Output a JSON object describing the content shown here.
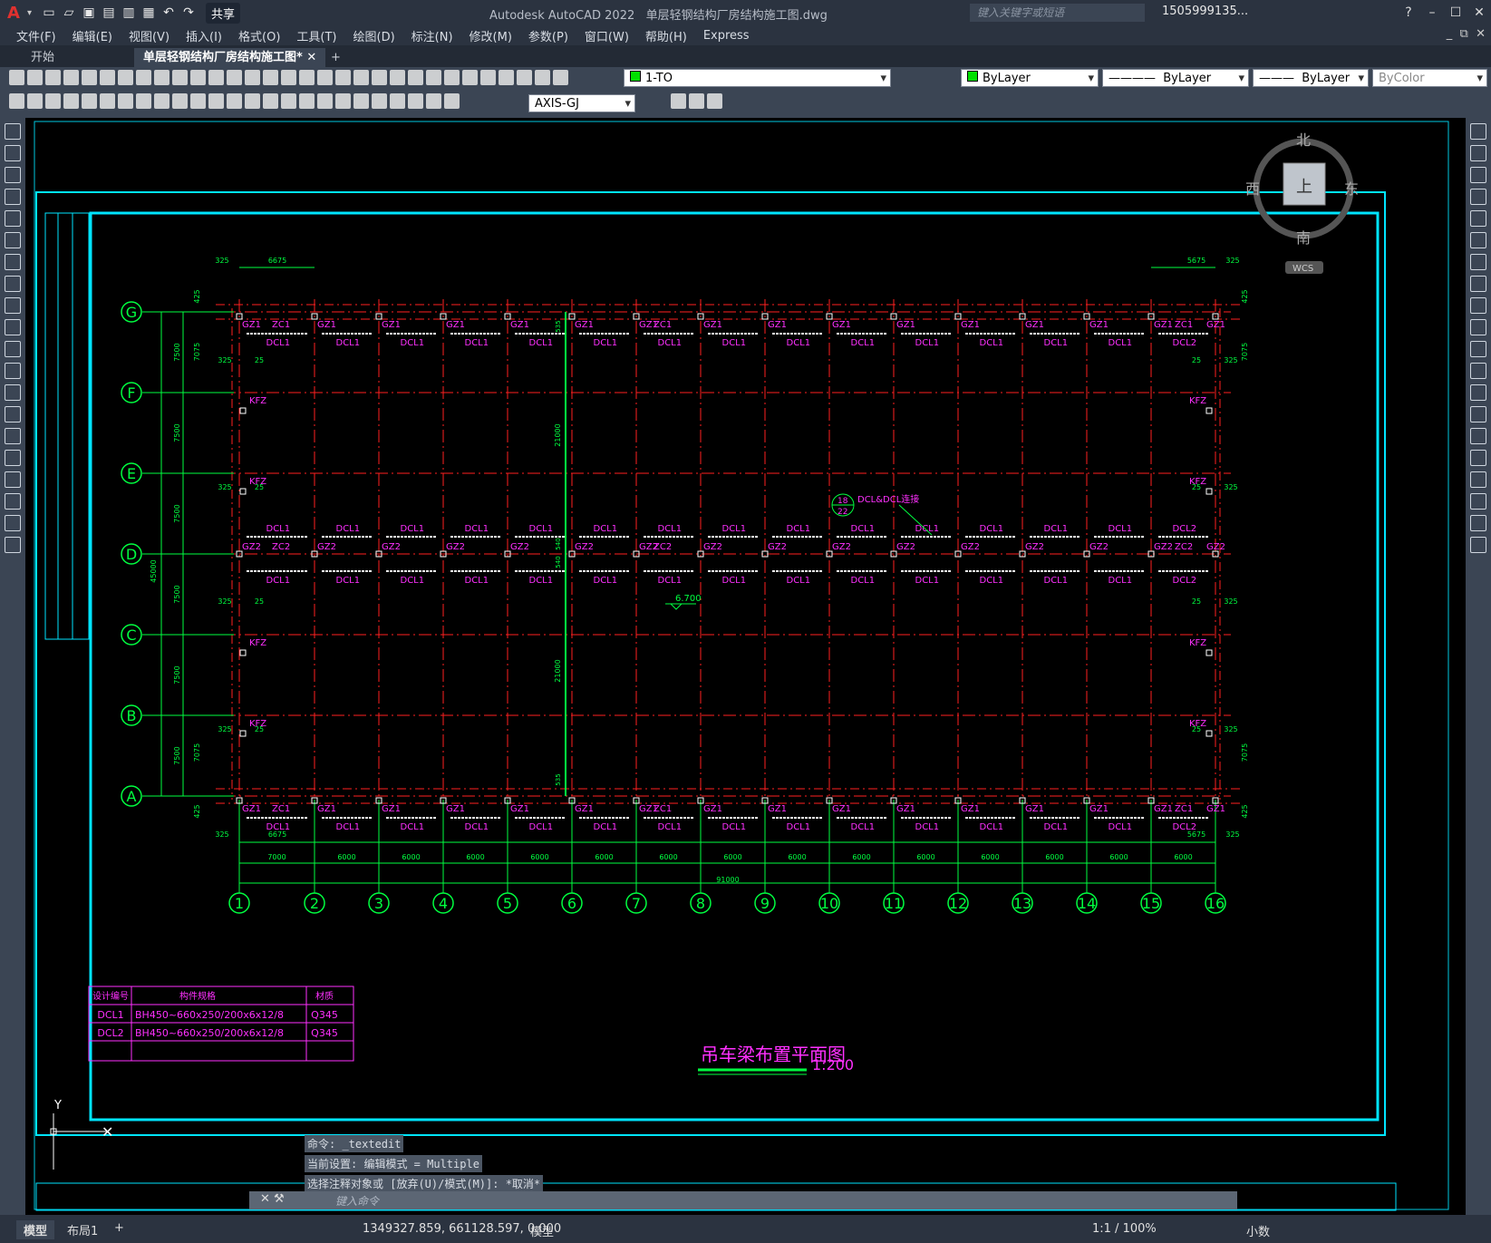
{
  "app": {
    "title": "Autodesk AutoCAD 2022",
    "file": "单层轻钢结构厂房结构施工图.dwg",
    "share": "共享",
    "search_placeholder": "键入关键字或短语",
    "user": "1505999135..."
  },
  "menu": [
    "文件(F)",
    "编辑(E)",
    "视图(V)",
    "插入(I)",
    "格式(O)",
    "工具(T)",
    "绘图(D)",
    "标注(N)",
    "修改(M)",
    "参数(P)",
    "窗口(W)",
    "帮助(H)",
    "Express"
  ],
  "tabs": {
    "start": "开始",
    "drawing": "单层轻钢结构厂房结构施工图*",
    "add": "+"
  },
  "properties": {
    "layer": "1-TO",
    "color": "ByLayer",
    "linetype": "ByLayer",
    "lineweight": "ByLayer",
    "plotstyle": "ByColor",
    "dimstyle": "AXIS-GJ"
  },
  "viewcube": {
    "north": "北",
    "south": "南",
    "east": "东",
    "west": "西",
    "top": "上",
    "wcs": "WCS"
  },
  "drawing": {
    "title": "吊车梁布置平面图",
    "scale": "1:200",
    "col_axes": [
      "1",
      "2",
      "3",
      "4",
      "5",
      "6",
      "7",
      "8",
      "9",
      "10",
      "11",
      "12",
      "13",
      "14",
      "15",
      "16"
    ],
    "row_axes": [
      "G",
      "F",
      "E",
      "D",
      "C",
      "B",
      "A"
    ],
    "spans": [
      "7000",
      "6000",
      "6000",
      "6000",
      "6000",
      "6000",
      "6000",
      "6000",
      "6000",
      "6000",
      "6000",
      "6000",
      "6000",
      "6000",
      "6000"
    ],
    "total_x": "91000",
    "total_y": "45000",
    "bay_y": "7500",
    "half": "21000",
    "end_left": "6675",
    "end_right": "5675",
    "dim_325": "325",
    "dim_25": "25",
    "dim_425": "425",
    "dim_7075": "7075",
    "dim_540": "540",
    "dim_535": "535",
    "elev": "6.700",
    "detail_num": "18",
    "detail_sheet": "22",
    "detail_text": "DCL&DCL连接",
    "labels": {
      "dcl1": "DCL1",
      "dcl2": "DCL2",
      "gz1": "GZ1",
      "gz2": "GZ2",
      "zc1": "ZC1",
      "zc2": "ZC2",
      "kfz": "KFZ"
    }
  },
  "table": {
    "headers": [
      "设计编号",
      "构件规格",
      "材质"
    ],
    "rows": [
      [
        "DCL1",
        "BH450~660x250/200x6x12/8",
        "Q345"
      ],
      [
        "DCL2",
        "BH450~660x250/200x6x12/8",
        "Q345"
      ]
    ]
  },
  "ucs": {
    "y": "Y"
  },
  "command": {
    "lines": [
      "命令: _textedit",
      "当前设置: 编辑模式 = Multiple",
      "选择注释对象或 [放弃(U)/模式(M)]: *取消*"
    ],
    "placeholder": "键入命令"
  },
  "status": {
    "model_tab": "模型",
    "layout_tab": "布局1",
    "add": "+",
    "coords": "1349327.859, 661128.597, 0.000",
    "model": "模型",
    "scale": "1:1 / 100%",
    "units": "小数"
  },
  "colors": {
    "canvas": "#000000",
    "grid": "#ff2020",
    "axis": "#00ff40",
    "member": "#ff30ff",
    "frame": "#00e5ff"
  }
}
